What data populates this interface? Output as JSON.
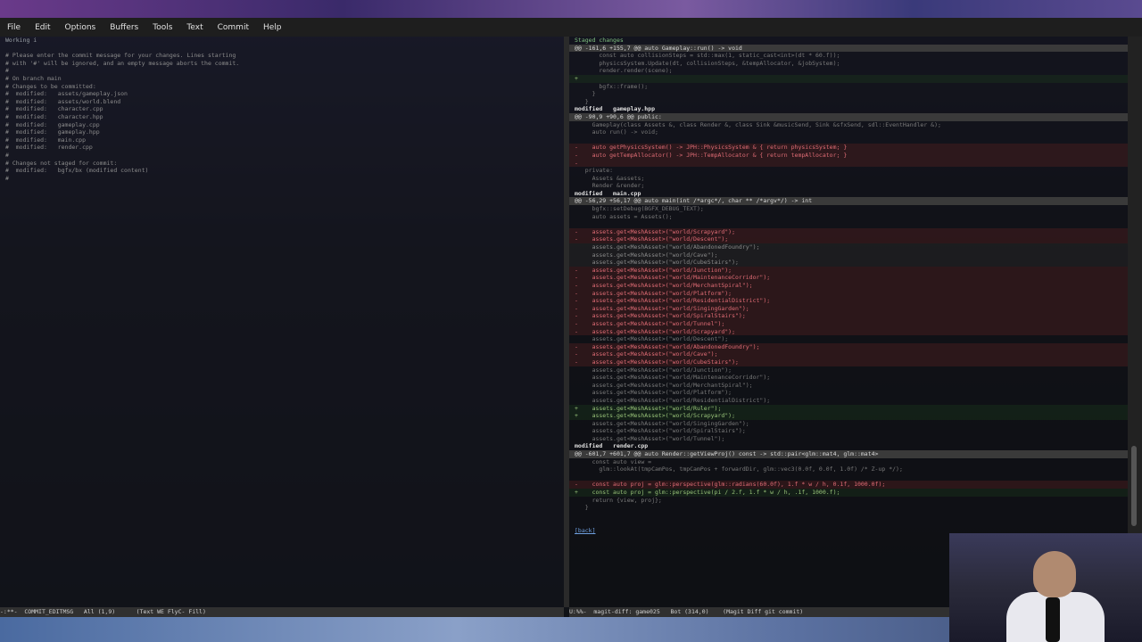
{
  "menu": [
    "File",
    "Edit",
    "Options",
    "Buffers",
    "Tools",
    "Text",
    "Commit",
    "Help"
  ],
  "left": {
    "lines": [
      {
        "t": "Working i",
        "c": "hdr"
      },
      {
        "t": "",
        "c": "comment"
      },
      {
        "t": "# Please enter the commit message for your changes. Lines starting",
        "c": "comment"
      },
      {
        "t": "# with '#' will be ignored, and an empty message aborts the commit.",
        "c": "comment"
      },
      {
        "t": "#",
        "c": "comment"
      },
      {
        "t": "# On branch main",
        "c": "comment"
      },
      {
        "t": "# Changes to be committed:",
        "c": "comment"
      },
      {
        "t": "#  modified:   assets/gameplay.json",
        "c": "comment"
      },
      {
        "t": "#  modified:   assets/world.blend",
        "c": "comment"
      },
      {
        "t": "#  modified:   character.cpp",
        "c": "comment"
      },
      {
        "t": "#  modified:   character.hpp",
        "c": "comment"
      },
      {
        "t": "#  modified:   gameplay.cpp",
        "c": "comment"
      },
      {
        "t": "#  modified:   gameplay.hpp",
        "c": "comment"
      },
      {
        "t": "#  modified:   main.cpp",
        "c": "comment"
      },
      {
        "t": "#  modified:   render.cpp",
        "c": "comment"
      },
      {
        "t": "#",
        "c": "comment"
      },
      {
        "t": "# Changes not staged for commit:",
        "c": "comment"
      },
      {
        "t": "#  modified:   bgfx/bx (modified content)",
        "c": "comment"
      },
      {
        "t": "#",
        "c": "comment"
      }
    ],
    "modeline": "-:**-  COMMIT_EDITMSG   All (1,9)      (Text WE FlyC- Fill)"
  },
  "right": {
    "lines": [
      {
        "t": "Staged changes",
        "c": "staged"
      },
      {
        "t": "@@ -161,6 +155,7 @@ auto Gameplay::run() -> void",
        "c": "hunk"
      },
      {
        "t": "       const auto collisionSteps = std::max(1, static_cast<int>(dt * 60.f));",
        "c": "ctx"
      },
      {
        "t": "       physicsSystem.Update(dt, collisionSteps, &tempAllocator, &jobSystem);",
        "c": "ctx"
      },
      {
        "t": "       render.render(scene);",
        "c": "ctx"
      },
      {
        "t": "+",
        "c": "added"
      },
      {
        "t": "       bgfx::frame();",
        "c": "ctx"
      },
      {
        "t": "     }",
        "c": "ctx"
      },
      {
        "t": "   }",
        "c": "ctx"
      },
      {
        "t": "modified   gameplay.hpp",
        "c": "sect"
      },
      {
        "t": "@@ -90,9 +90,6 @@ public:",
        "c": "hunk"
      },
      {
        "t": "     Gameplay(class Assets &, class Render &, class Sink &musicSend, Sink &sfxSend, sdl::EventHandler &);",
        "c": "ctx"
      },
      {
        "t": "     auto run() -> void;",
        "c": "ctx"
      },
      {
        "t": "",
        "c": "ctx"
      },
      {
        "t": "-    auto getPhysicsSystem() -> JPH::PhysicsSystem & { return physicsSystem; }",
        "c": "removed"
      },
      {
        "t": "-    auto getTempAllocator() -> JPH::TempAllocator & { return tempAllocator; }",
        "c": "removed"
      },
      {
        "t": "-",
        "c": "removed"
      },
      {
        "t": "   private:",
        "c": "ctx"
      },
      {
        "t": "     Assets &assets;",
        "c": "ctx"
      },
      {
        "t": "     Render &render;",
        "c": "ctx"
      },
      {
        "t": "modified   main.cpp",
        "c": "sect"
      },
      {
        "t": "@@ -56,29 +56,17 @@ auto main(int /*argc*/, char ** /*argv*/) -> int",
        "c": "hunk"
      },
      {
        "t": "     bgfx::setDebug(BGFX_DEBUG_TEXT);",
        "c": "ctx"
      },
      {
        "t": "     auto assets = Assets();",
        "c": "ctx"
      },
      {
        "t": "",
        "c": "ctx"
      },
      {
        "t": "-    assets.get<MeshAsset>(\"world/Scrapyard\");",
        "c": "removed"
      },
      {
        "t": "-    assets.get<MeshAsset>(\"world/Descent\");",
        "c": "removed"
      },
      {
        "t": "     assets.get<MeshAsset>(\"world/AbandonedFoundry\");",
        "c": "ctxb"
      },
      {
        "t": "     assets.get<MeshAsset>(\"world/Cave\");",
        "c": "ctxb"
      },
      {
        "t": "     assets.get<MeshAsset>(\"world/CubeStairs\");",
        "c": "ctxb"
      },
      {
        "t": "-    assets.get<MeshAsset>(\"world/Junction\");",
        "c": "removed"
      },
      {
        "t": "-    assets.get<MeshAsset>(\"world/MaintenanceCorridor\");",
        "c": "removed"
      },
      {
        "t": "-    assets.get<MeshAsset>(\"world/MerchantSpiral\");",
        "c": "removed"
      },
      {
        "t": "-    assets.get<MeshAsset>(\"world/Platform\");",
        "c": "removed"
      },
      {
        "t": "-    assets.get<MeshAsset>(\"world/ResidentialDistrict\");",
        "c": "removed"
      },
      {
        "t": "-    assets.get<MeshAsset>(\"world/SingingGarden\");",
        "c": "removed"
      },
      {
        "t": "-    assets.get<MeshAsset>(\"world/SpiralStairs\");",
        "c": "removed"
      },
      {
        "t": "-    assets.get<MeshAsset>(\"world/Tunnel\");",
        "c": "removed"
      },
      {
        "t": "-    assets.get<MeshAsset>(\"world/Scrapyard\");",
        "c": "removed"
      },
      {
        "t": "     assets.get<MeshAsset>(\"world/Descent\");",
        "c": "ctx"
      },
      {
        "t": "-    assets.get<MeshAsset>(\"world/AbandonedFoundry\");",
        "c": "removed"
      },
      {
        "t": "-    assets.get<MeshAsset>(\"world/Cave\");",
        "c": "removed"
      },
      {
        "t": "-    assets.get<MeshAsset>(\"world/CubeStairs\");",
        "c": "removed"
      },
      {
        "t": "     assets.get<MeshAsset>(\"world/Junction\");",
        "c": "ctx"
      },
      {
        "t": "     assets.get<MeshAsset>(\"world/MaintenanceCorridor\");",
        "c": "ctx"
      },
      {
        "t": "     assets.get<MeshAsset>(\"world/MerchantSpiral\");",
        "c": "ctx"
      },
      {
        "t": "     assets.get<MeshAsset>(\"world/Platform\");",
        "c": "ctx"
      },
      {
        "t": "     assets.get<MeshAsset>(\"world/ResidentialDistrict\");",
        "c": "ctx"
      },
      {
        "t": "+    assets.get<MeshAsset>(\"world/Ruler\");",
        "c": "added"
      },
      {
        "t": "+    assets.get<MeshAsset>(\"world/Scrapyard\");",
        "c": "added"
      },
      {
        "t": "     assets.get<MeshAsset>(\"world/SingingGarden\");",
        "c": "ctx"
      },
      {
        "t": "     assets.get<MeshAsset>(\"world/SpiralStairs\");",
        "c": "ctx"
      },
      {
        "t": "     assets.get<MeshAsset>(\"world/Tunnel\");",
        "c": "ctx"
      },
      {
        "t": "modified   render.cpp",
        "c": "sect"
      },
      {
        "t": "@@ -601,7 +601,7 @@ auto Render::getViewProj() const -> std::pair<glm::mat4, glm::mat4>",
        "c": "hunk"
      },
      {
        "t": "     const auto view =",
        "c": "ctx"
      },
      {
        "t": "       glm::lookAt(tmpCamPos, tmpCamPos + forwardDir, glm::vec3(0.0f, 0.0f, 1.0f) /* Z-up */);",
        "c": "ctx"
      },
      {
        "t": "",
        "c": "ctx"
      },
      {
        "t": "-    const auto proj = glm::perspective(glm::radians(60.0f), 1.f * w / h, 0.1f, 1000.0f);",
        "c": "removed"
      },
      {
        "t": "+    const auto proj = glm::perspective(pi / 2.f, 1.f * w / h, .1f, 1000.f);",
        "c": "added"
      },
      {
        "t": "     return {view, proj};",
        "c": "ctx"
      },
      {
        "t": "   }",
        "c": "ctx"
      },
      {
        "t": "",
        "c": "ctx"
      },
      {
        "t": "",
        "c": "ctx"
      },
      {
        "t": "[back]",
        "c": "link"
      }
    ],
    "modeline": "U:%%-  magit-diff: game025   Bot (314,0)    (Magit Diff git commit)"
  }
}
